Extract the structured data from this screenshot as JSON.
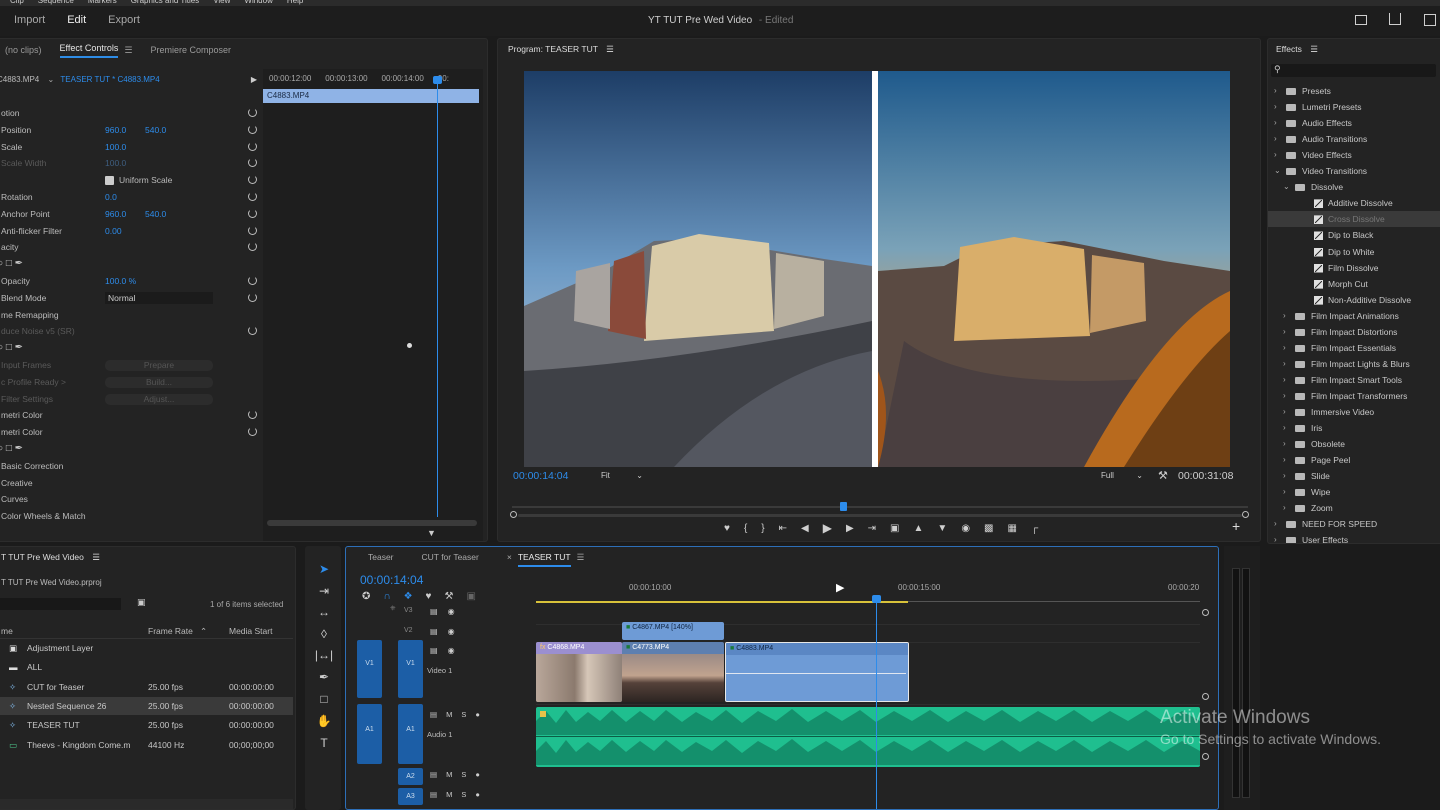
{
  "menubar": {
    "items": [
      "Clip",
      "Sequence",
      "Markers",
      "Graphics and Titles",
      "View",
      "Window",
      "Help"
    ]
  },
  "header": {
    "tabs": [
      "Import",
      "Edit",
      "Export"
    ],
    "active_tab": "Edit",
    "title": "YT TUT Pre Wed Video",
    "title_suffix": "- Edited"
  },
  "effect_controls": {
    "tabs": [
      "(no clips)",
      "Effect Controls",
      "Premiere Composer"
    ],
    "source_clip": "C4883.MP4",
    "sequence_clip": "TEASER TUT * C4883.MP4",
    "times": [
      "00:00:12:00",
      "00:00:13:00",
      "00:00:14:00",
      "00:"
    ],
    "timeline_clip_label": "C4883.MP4",
    "rows": [
      {
        "label": "otion",
        "v1": "",
        "v2": "",
        "reset": true
      },
      {
        "label": "Position",
        "v1": "960.0",
        "v2": "540.0",
        "reset": true
      },
      {
        "label": "Scale",
        "v1": "100.0",
        "v2": "",
        "reset": true
      },
      {
        "label": "Scale Width",
        "v1": "100.0",
        "v2": "",
        "reset": true,
        "dim": true
      },
      {
        "label": "",
        "v1": "Uniform Scale",
        "v2": "",
        "reset": true,
        "checkbox": true
      },
      {
        "label": "Rotation",
        "v1": "0.0",
        "v2": "",
        "reset": true
      },
      {
        "label": "Anchor Point",
        "v1": "960.0",
        "v2": "540.0",
        "reset": true
      },
      {
        "label": "Anti-flicker Filter",
        "v1": "0.00",
        "v2": "",
        "reset": true
      },
      {
        "label": "acity",
        "v1": "",
        "v2": "",
        "reset": true
      },
      {
        "label": "",
        "v1": "",
        "v2": "",
        "reset": false,
        "masks": true
      },
      {
        "label": "Opacity",
        "v1": "100.0 %",
        "v2": "",
        "reset": true
      },
      {
        "label": "Blend Mode",
        "v1": "Normal",
        "v2": "",
        "reset": true,
        "select": true
      },
      {
        "label": "me Remapping",
        "v1": "",
        "v2": "",
        "reset": false
      },
      {
        "label": "duce Noise v5 (SR)",
        "v1": "",
        "v2": "",
        "reset": true,
        "dim": true
      },
      {
        "label": "",
        "v1": "",
        "v2": "",
        "reset": false,
        "masks": true
      },
      {
        "label": "Input Frames",
        "v1": "Prepare",
        "v2": "",
        "reset": false,
        "dim": true,
        "button": true
      },
      {
        "label": "c Profile Ready >",
        "v1": "Build...",
        "v2": "",
        "reset": false,
        "dim": true,
        "button": true
      },
      {
        "label": "Filter Settings",
        "v1": "Adjust...",
        "v2": "",
        "reset": false,
        "dim": true,
        "button": true
      },
      {
        "label": "metri Color",
        "v1": "",
        "v2": "",
        "reset": true
      },
      {
        "label": "metri Color",
        "v1": "",
        "v2": "",
        "reset": true
      },
      {
        "label": "",
        "v1": "",
        "v2": "",
        "reset": false,
        "masks": true
      },
      {
        "label": "Basic Correction",
        "v1": "",
        "v2": "",
        "reset": false
      },
      {
        "label": "Creative",
        "v1": "",
        "v2": "",
        "reset": false
      },
      {
        "label": "Curves",
        "v1": "",
        "v2": "",
        "reset": false
      },
      {
        "label": "Color Wheels & Match",
        "v1": "",
        "v2": "",
        "reset": false
      }
    ]
  },
  "program": {
    "title": "Program: TEASER TUT",
    "current_time": "00:00:14:04",
    "fit": "Fit",
    "quality": "Full",
    "duration": "00:00:31:08",
    "playhead_fraction": 0.45
  },
  "effects": {
    "title": "Effects",
    "search_placeholder": "",
    "items": [
      {
        "label": "Presets",
        "level": 0,
        "kind": "preset-folder",
        "expanded": false
      },
      {
        "label": "Lumetri Presets",
        "level": 0,
        "kind": "preset-folder",
        "expanded": false
      },
      {
        "label": "Audio Effects",
        "level": 0,
        "kind": "folder",
        "expanded": false
      },
      {
        "label": "Audio Transitions",
        "level": 0,
        "kind": "folder",
        "expanded": false
      },
      {
        "label": "Video Effects",
        "level": 0,
        "kind": "folder",
        "expanded": false
      },
      {
        "label": "Video Transitions",
        "level": 0,
        "kind": "folder",
        "expanded": true
      },
      {
        "label": "Dissolve",
        "level": 1,
        "kind": "folder",
        "expanded": true
      },
      {
        "label": "Additive Dissolve",
        "level": 2,
        "kind": "effect"
      },
      {
        "label": "Cross Dissolve",
        "level": 2,
        "kind": "effect",
        "selected": true
      },
      {
        "label": "Dip to Black",
        "level": 2,
        "kind": "effect"
      },
      {
        "label": "Dip to White",
        "level": 2,
        "kind": "effect"
      },
      {
        "label": "Film Dissolve",
        "level": 2,
        "kind": "effect"
      },
      {
        "label": "Morph Cut",
        "level": 2,
        "kind": "effect"
      },
      {
        "label": "Non-Additive Dissolve",
        "level": 2,
        "kind": "effect"
      },
      {
        "label": "Film Impact Animations",
        "level": 1,
        "kind": "folder",
        "expanded": false
      },
      {
        "label": "Film Impact Distortions",
        "level": 1,
        "kind": "folder",
        "expanded": false
      },
      {
        "label": "Film Impact Essentials",
        "level": 1,
        "kind": "folder",
        "expanded": false
      },
      {
        "label": "Film Impact Lights & Blurs",
        "level": 1,
        "kind": "folder",
        "expanded": false
      },
      {
        "label": "Film Impact Smart Tools",
        "level": 1,
        "kind": "folder",
        "expanded": false
      },
      {
        "label": "Film Impact Transformers",
        "level": 1,
        "kind": "folder",
        "expanded": false
      },
      {
        "label": "Immersive Video",
        "level": 1,
        "kind": "folder",
        "expanded": false
      },
      {
        "label": "Iris",
        "level": 1,
        "kind": "folder",
        "expanded": false
      },
      {
        "label": "Obsolete",
        "level": 1,
        "kind": "folder",
        "expanded": false
      },
      {
        "label": "Page Peel",
        "level": 1,
        "kind": "folder",
        "expanded": false
      },
      {
        "label": "Slide",
        "level": 1,
        "kind": "folder",
        "expanded": false
      },
      {
        "label": "Wipe",
        "level": 1,
        "kind": "folder",
        "expanded": false
      },
      {
        "label": "Zoom",
        "level": 1,
        "kind": "folder",
        "expanded": false
      },
      {
        "label": "NEED FOR SPEED",
        "level": 0,
        "kind": "folder",
        "expanded": false
      },
      {
        "label": "User Effects",
        "level": 0,
        "kind": "folder",
        "expanded": false
      }
    ]
  },
  "project": {
    "tab": "T TUT Pre Wed Video",
    "file": "T TUT Pre Wed Video.prproj",
    "selection": "1 of 6 items selected",
    "columns": [
      "me",
      "Frame Rate",
      "Media Start"
    ],
    "items": [
      {
        "name": "Adjustment Layer",
        "rate": "",
        "start": "",
        "icon": "adjustment"
      },
      {
        "name": "ALL",
        "rate": "",
        "start": "",
        "icon": "bin"
      },
      {
        "name": "CUT for Teaser",
        "rate": "25.00 fps",
        "start": "00:00:00:00",
        "icon": "sequence"
      },
      {
        "name": "Nested Sequence 26",
        "rate": "25.00 fps",
        "start": "00:00:00:00",
        "icon": "sequence",
        "selected": true
      },
      {
        "name": "TEASER TUT",
        "rate": "25.00 fps",
        "start": "00:00:00:00",
        "icon": "sequence"
      },
      {
        "name": "Theevs - Kingdom Come.m",
        "rate": "44100 Hz",
        "start": "00;00;00;00",
        "icon": "audio"
      }
    ]
  },
  "timeline": {
    "tabs": [
      "Teaser",
      "CUT for Teaser",
      "TEASER TUT"
    ],
    "active_tab": "TEASER TUT",
    "timecode": "00:00:14:04",
    "ruler": [
      "00:00:10:00",
      "00:00:15:00",
      "00:00:20"
    ],
    "tracks": {
      "v3": "V3",
      "v2": "V2",
      "v1": "V1",
      "v1_name": "Video 1",
      "a1": "A1",
      "a1_name": "Audio 1",
      "a2": "A2",
      "a3": "A3",
      "m": "M",
      "s": "S"
    },
    "clips": {
      "v2": "C4867.MP4 [140%]",
      "v1a": "C4868.MP4",
      "v1b": "C4773.MP4",
      "v1c": "C4883.MP4"
    }
  },
  "watermark": {
    "title": "Activate Windows",
    "subtitle": "Go to Settings to activate Windows."
  },
  "colors": {
    "accent": "#2d8ceb",
    "audio": "#1fbf8f",
    "clip_blue": "#6e9bd6"
  }
}
